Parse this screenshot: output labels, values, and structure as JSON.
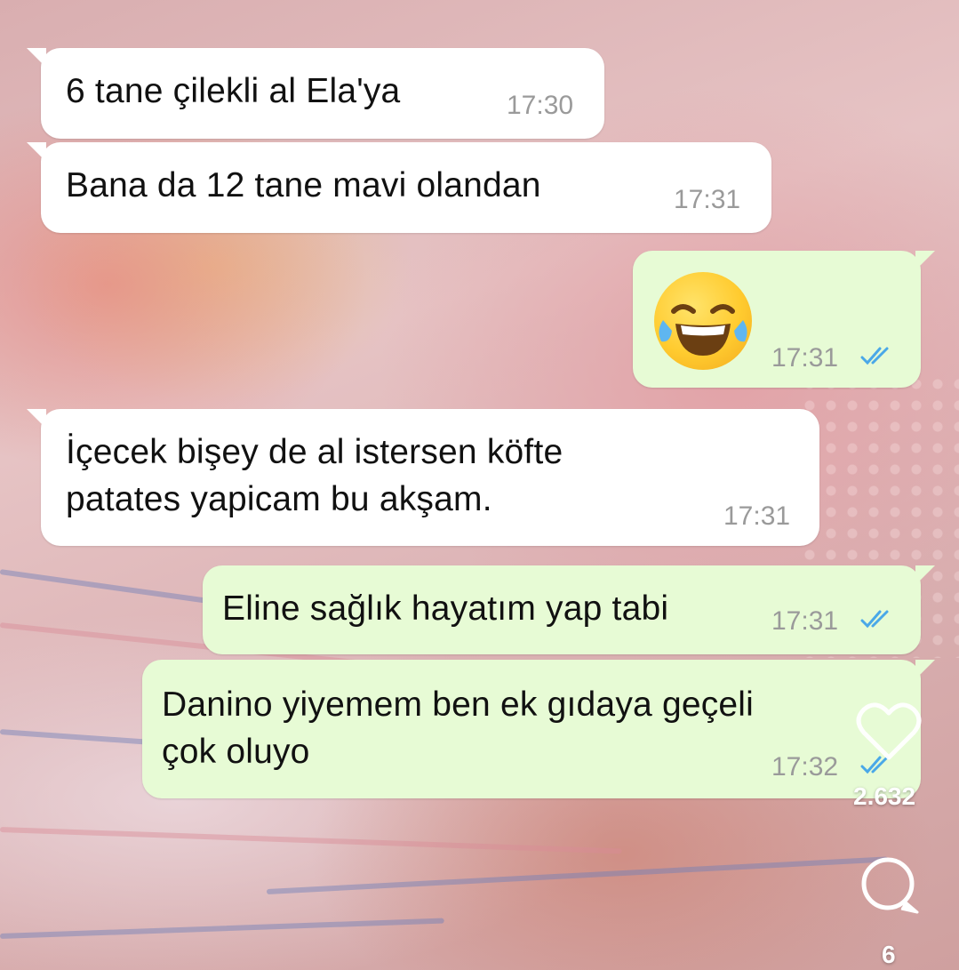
{
  "messages": [
    {
      "text": "6 tane çilekli al Ela'ya",
      "time": "17:30",
      "direction": "incoming"
    },
    {
      "text": "Bana da 12 tane mavi olandan",
      "time": "17:31",
      "direction": "incoming"
    },
    {
      "emoji": "face-with-tears-of-joy",
      "time": "17:31",
      "direction": "outgoing",
      "read": true
    },
    {
      "line1": "İçecek bişey de al istersen köfte",
      "line2": "patates yapicam bu akşam.",
      "time": "17:31",
      "direction": "incoming"
    },
    {
      "text": "Eline sağlık hayatım yap tabi",
      "time": "17:31",
      "direction": "outgoing",
      "read": true
    },
    {
      "line1": "Danino yiyemem ben ek gıdaya geçeli",
      "line2": "çok oluyo",
      "time": "17:32",
      "direction": "outgoing",
      "read": true
    }
  ],
  "side_actions": {
    "like_count": "2.632",
    "comment_count": "6"
  },
  "colors": {
    "incoming_bubble": "#ffffff",
    "outgoing_bubble": "#e7fbd5",
    "read_ticks": "#4aa8e8"
  }
}
